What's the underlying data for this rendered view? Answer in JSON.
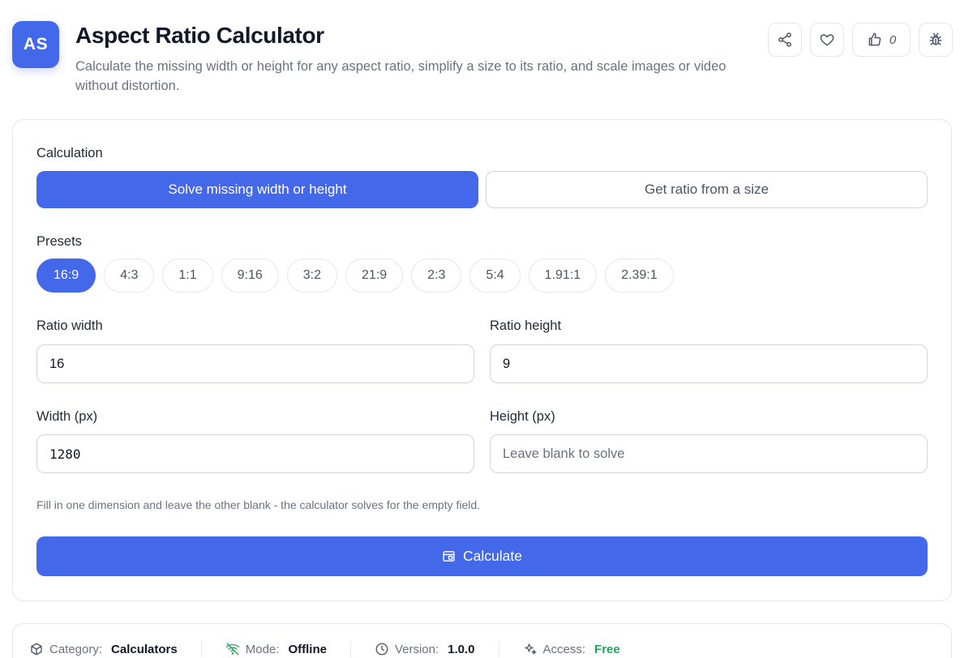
{
  "header": {
    "logo_text": "AS",
    "title": "Aspect Ratio Calculator",
    "subtitle": "Calculate the missing width or height for any aspect ratio, simplify a size to its ratio, and scale images or video without distortion.",
    "like_count": "0",
    "icons": [
      "share-icon",
      "heart-icon",
      "thumbs-up-icon",
      "bug-icon"
    ]
  },
  "calculation": {
    "label": "Calculation",
    "options": [
      "Solve missing width or height",
      "Get ratio from a size"
    ],
    "selected": "Solve missing width or height"
  },
  "presets": {
    "label": "Presets",
    "items": [
      "16:9",
      "4:3",
      "1:1",
      "9:16",
      "3:2",
      "21:9",
      "2:3",
      "5:4",
      "1.91:1",
      "2.39:1"
    ],
    "selected": "16:9"
  },
  "fields": {
    "ratio_width": {
      "label": "Ratio width",
      "value": "16"
    },
    "ratio_height": {
      "label": "Ratio height",
      "value": "9"
    },
    "width_px": {
      "label": "Width (px)",
      "value": "1280"
    },
    "height_px": {
      "label": "Height (px)",
      "value": "",
      "placeholder": "Leave blank to solve"
    }
  },
  "hint": "Fill in one dimension and leave the other blank - the calculator solves for the empty field.",
  "calculate_button": "Calculate",
  "info": {
    "category_label": "Category:",
    "category_value": "Calculators",
    "mode_label": "Mode:",
    "mode_value": "Offline",
    "version_label": "Version:",
    "version_value": "1.0.0",
    "access_label": "Access:",
    "access_value": "Free"
  },
  "colors": {
    "accent": "#4468ea",
    "free_green": "#22a35a",
    "border": "#e5e7eb"
  }
}
